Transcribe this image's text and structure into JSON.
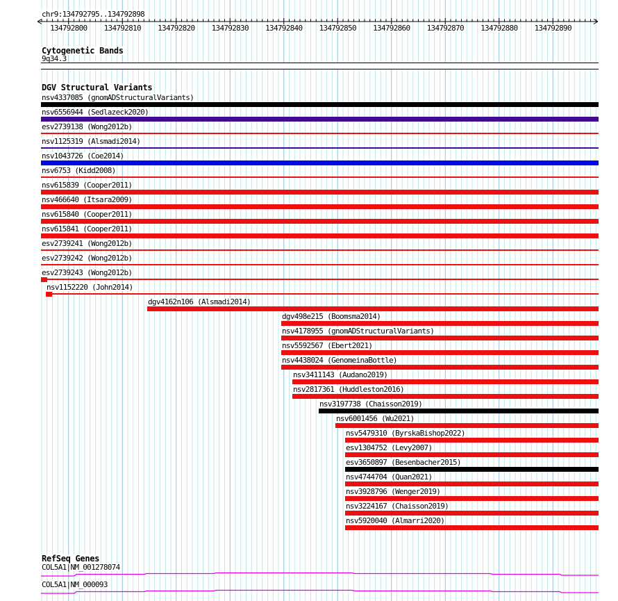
{
  "header": {
    "title": "chr9:134792795..134792898",
    "chrom": "chr9"
  },
  "ruler": {
    "start": 134792795,
    "end": 134792898,
    "major_step": 10,
    "minor_step": 1,
    "tick_labels": [
      "134792800",
      "134792810",
      "134792820",
      "134792830",
      "134792840",
      "134792850",
      "134792860",
      "134792870",
      "134792880",
      "134792890"
    ]
  },
  "cytobands": {
    "section_title": "Cytogenetic Bands",
    "band": "9q34.3"
  },
  "variants": {
    "section_title": "DGV Structural Variants",
    "rows": [
      {
        "id": "nsv4337085",
        "study": "gnomADStructuralVariants",
        "label": "nsv4337085 (gnomADStructuralVariants)",
        "color": "black",
        "shape": "thick",
        "indent": 59
      },
      {
        "id": "nsv6556944",
        "study": "Sedlazeck2020",
        "label": "nsv6556944 (Sedlazeck2020)",
        "color": "purple",
        "shape": "thick",
        "indent": 59
      },
      {
        "id": "esv2739138",
        "study": "Wong2012b",
        "label": "esv2739138 (Wong2012b)",
        "color": "red",
        "shape": "thin",
        "indent": 59
      },
      {
        "id": "nsv1125319",
        "study": "Alsmadi2014",
        "label": "nsv1125319 (Alsmadi2014)",
        "color": "purple",
        "shape": "thin",
        "indent": 59
      },
      {
        "id": "nsv1043726",
        "study": "Coe2014",
        "label": "nsv1043726 (Coe2014)",
        "color": "blue",
        "shape": "thick",
        "indent": 59
      },
      {
        "id": "nsv6753",
        "study": "Kidd2008",
        "label": "nsv6753 (Kidd2008)",
        "color": "red",
        "shape": "thin",
        "indent": 59
      },
      {
        "id": "nsv615839",
        "study": "Cooper2011",
        "label": "nsv615839 (Cooper2011)",
        "color": "red",
        "shape": "thick",
        "indent": 59
      },
      {
        "id": "nsv466640",
        "study": "Itsara2009",
        "label": "nsv466640 (Itsara2009)",
        "color": "red",
        "shape": "thick",
        "indent": 59
      },
      {
        "id": "nsv615840",
        "study": "Cooper2011",
        "label": "nsv615840 (Cooper2011)",
        "color": "red",
        "shape": "thick",
        "indent": 59
      },
      {
        "id": "nsv615841",
        "study": "Cooper2011",
        "label": "nsv615841 (Cooper2011)",
        "color": "red",
        "shape": "thick",
        "indent": 59
      },
      {
        "id": "esv2739241",
        "study": "Wong2012b",
        "label": "esv2739241 (Wong2012b)",
        "color": "red",
        "shape": "thin",
        "indent": 59
      },
      {
        "id": "esv2739242",
        "study": "Wong2012b",
        "label": "esv2739242 (Wong2012b)",
        "color": "red",
        "shape": "thin",
        "indent": 59
      },
      {
        "id": "esv2739243",
        "study": "Wong2012b",
        "label": "esv2739243 (Wong2012b)",
        "color": "red",
        "shape": "thin-block",
        "indent": 59
      },
      {
        "id": "nsv1152220",
        "study": "John2014",
        "label": "nsv1152220 (John2014)",
        "color": "red",
        "shape": "thin-block",
        "indent": 66
      },
      {
        "id": "dgv4162n106",
        "study": "Alsmadi2014",
        "label": "dgv4162n106 (Alsmadi2014)",
        "color": "red",
        "shape": "thick",
        "indent": 212
      },
      {
        "id": "dgv498e215",
        "study": "Boomsma2014",
        "label": "dgv498e215 (Boomsma2014)",
        "color": "red",
        "shape": "thick",
        "indent": 405
      },
      {
        "id": "nsv4178955",
        "study": "gnomADStructuralVariants",
        "label": "nsv4178955 (gnomADStructuralVariants)",
        "color": "red",
        "shape": "thick",
        "indent": 405
      },
      {
        "id": "nsv5592567",
        "study": "Ebert2021",
        "label": "nsv5592567 (Ebert2021)",
        "color": "red",
        "shape": "thick",
        "indent": 405
      },
      {
        "id": "nsv4438024",
        "study": "GenomeinaBottle",
        "label": "nsv4438024 (GenomeinaBottle)",
        "color": "red",
        "shape": "thick",
        "indent": 405
      },
      {
        "id": "nsv3411143",
        "study": "Audano2019",
        "label": "nsv3411143 (Audano2019)",
        "color": "red",
        "shape": "thick",
        "indent": 421
      },
      {
        "id": "nsv2817361",
        "study": "Huddleston2016",
        "label": "nsv2817361 (Huddleston2016)",
        "color": "red",
        "shape": "thick",
        "indent": 421
      },
      {
        "id": "nsv3197738",
        "study": "Chaisson2019",
        "label": "nsv3197738 (Chaisson2019)",
        "color": "black",
        "shape": "thick",
        "indent": 459
      },
      {
        "id": "nsv6001456",
        "study": "Wu2021",
        "label": "nsv6001456 (Wu2021)",
        "color": "red",
        "shape": "thick",
        "indent": 483
      },
      {
        "id": "nsv5479310",
        "study": "ByrskaBishop2022",
        "label": "nsv5479310 (ByrskaBishop2022)",
        "color": "red",
        "shape": "thick",
        "indent": 497
      },
      {
        "id": "esv1304752",
        "study": "Levy2007",
        "label": "esv1304752 (Levy2007)",
        "color": "red",
        "shape": "thick",
        "indent": 497
      },
      {
        "id": "esv3650897",
        "study": "Besenbacher2015",
        "label": "esv3650897 (Besenbacher2015)",
        "color": "black",
        "shape": "thick",
        "indent": 497
      },
      {
        "id": "nsv4744704",
        "study": "Quan2021",
        "label": "nsv4744704 (Quan2021)",
        "color": "red",
        "shape": "thick",
        "indent": 497
      },
      {
        "id": "nsv3928796",
        "study": "Wenger2019",
        "label": "nsv3928796 (Wenger2019)",
        "color": "red",
        "shape": "thick",
        "indent": 497
      },
      {
        "id": "nsv3224167",
        "study": "Chaisson2019",
        "label": "nsv3224167 (Chaisson2019)",
        "color": "red",
        "shape": "thick",
        "indent": 497
      },
      {
        "id": "nsv5920040",
        "study": "Almarri2020",
        "label": "nsv5920040 (Almarri2020)",
        "color": "red",
        "shape": "thick",
        "indent": 497
      }
    ]
  },
  "genes": {
    "section_title": "RefSeq Genes",
    "items": [
      {
        "label": "COL5A1|NM_001278074"
      },
      {
        "label": "COL5A1|NM_000093"
      }
    ]
  },
  "colors": {
    "variant_black": "#000000",
    "variant_purple": "#3F0C91",
    "variant_blue": "#0009E8",
    "variant_red": "#EE0F0F",
    "gene_line": "#E800E8",
    "grid_minor": "#C2E9EA",
    "grid_major": "#8FC4DC",
    "ruler": "#000000",
    "text": "#000000"
  }
}
